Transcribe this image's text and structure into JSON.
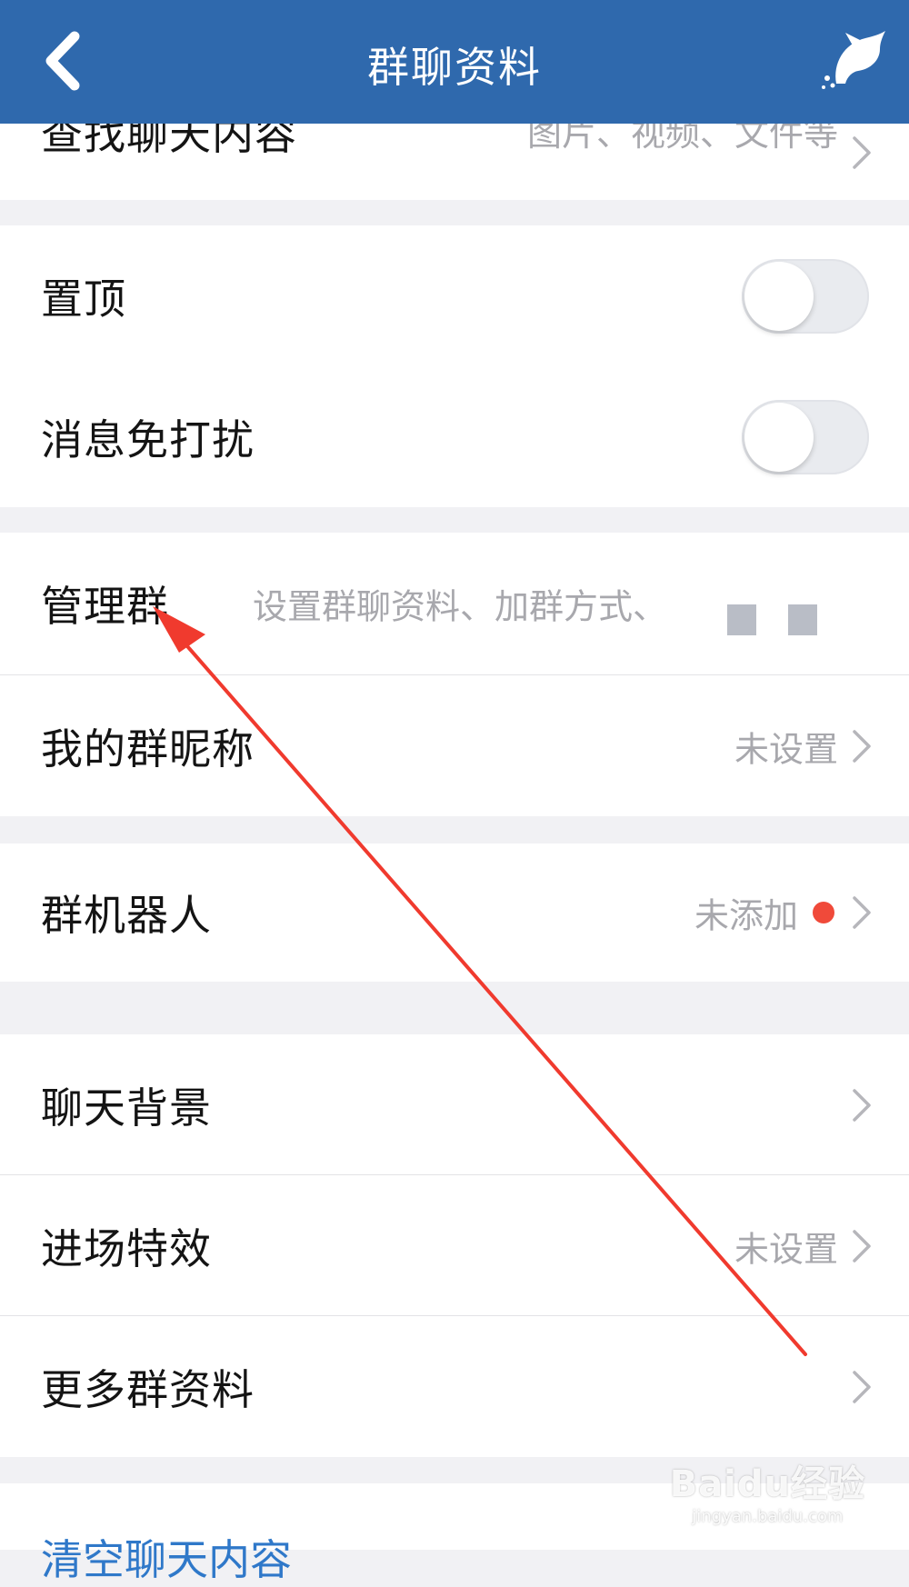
{
  "header": {
    "title": "群聊资料",
    "back_icon": "chevron-left-icon",
    "right_icon": "dolphin-icon",
    "bg_color": "#2f69ad"
  },
  "partial_row": {
    "label": "查找聊天内容",
    "value": "图片、视频、文件等"
  },
  "toggles": [
    {
      "label": "置顶",
      "on": false
    },
    {
      "label": "消息免打扰",
      "on": false
    }
  ],
  "manage_group": {
    "label": "管理群",
    "description": "设置群聊资料、加群方式、"
  },
  "nickname": {
    "label": "我的群昵称",
    "value": "未设置"
  },
  "robot": {
    "label": "群机器人",
    "value": "未添加",
    "dot_color": "#f04a3a"
  },
  "settings": [
    {
      "label": "聊天背景",
      "value": ""
    },
    {
      "label": "进场特效",
      "value": "未设置"
    },
    {
      "label": "更多群资料",
      "value": ""
    }
  ],
  "bottom": {
    "clear_label": "清空聊天内容"
  },
  "annotation": {
    "color": "#f03a2e"
  },
  "watermark": {
    "logo": "Baidu经验",
    "url": "jingyan.baidu.com"
  }
}
